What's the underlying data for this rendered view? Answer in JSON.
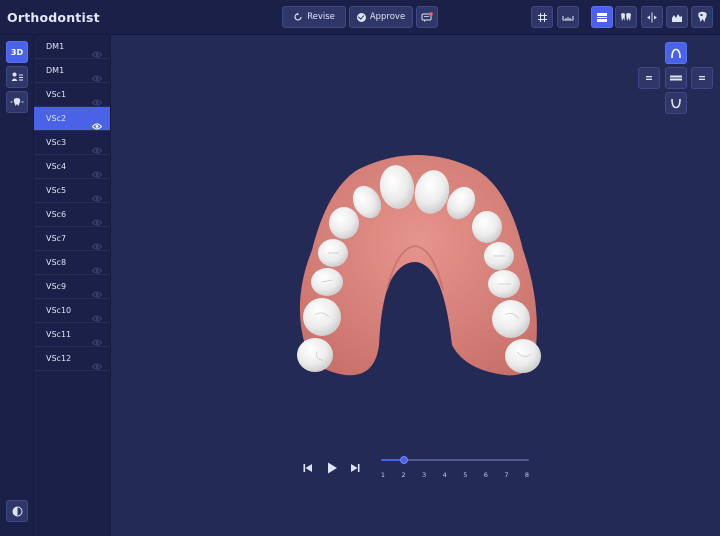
{
  "app": {
    "title": "Orthodontist"
  },
  "toolbar": {
    "revise_label": "Revise",
    "approve_label": "Approve",
    "message_icon": "chat-bubble-icon",
    "tools": [
      {
        "name": "grid-icon",
        "active": false
      },
      {
        "name": "ruler-icon",
        "active": false
      },
      {
        "name": "occlusion-icon",
        "active": true
      },
      {
        "name": "teeth-icon",
        "active": false
      },
      {
        "name": "split-view-icon",
        "active": false
      },
      {
        "name": "chart-icon",
        "active": false
      },
      {
        "name": "single-tooth-icon",
        "active": false
      }
    ]
  },
  "left_rail": {
    "view_3d_label": "3D",
    "items": [
      "3d-view-button",
      "patient-info-icon",
      "tooth-chart-icon",
      "contrast-icon"
    ]
  },
  "stages": {
    "items": [
      {
        "label": "DM1",
        "selected": false
      },
      {
        "label": "DM1",
        "selected": false
      },
      {
        "label": "VSc1",
        "selected": false
      },
      {
        "label": "VSc2",
        "selected": true
      },
      {
        "label": "VSc3",
        "selected": false
      },
      {
        "label": "VSc4",
        "selected": false
      },
      {
        "label": "VSc5",
        "selected": false
      },
      {
        "label": "VSc6",
        "selected": false
      },
      {
        "label": "VSc7",
        "selected": false
      },
      {
        "label": "VSc8",
        "selected": false
      },
      {
        "label": "VSc9",
        "selected": false
      },
      {
        "label": "VSc10",
        "selected": false
      },
      {
        "label": "VSc11",
        "selected": false
      },
      {
        "label": "VSc12",
        "selected": false
      }
    ]
  },
  "view_controls": {
    "active": "upper-arch",
    "buttons": [
      "upper-arch-icon",
      "left-view-icon",
      "front-view-icon",
      "right-view-icon",
      "lower-arch-icon"
    ]
  },
  "player": {
    "steps": [
      "1",
      "2",
      "3",
      "4",
      "5",
      "6",
      "7",
      "8"
    ],
    "current_step": 2,
    "total_steps": 8
  },
  "colors": {
    "accent": "#4a63e6",
    "background": "#232a56",
    "panel": "#1b2048",
    "gum": "#d9837c",
    "tooth": "#eeeeee"
  }
}
